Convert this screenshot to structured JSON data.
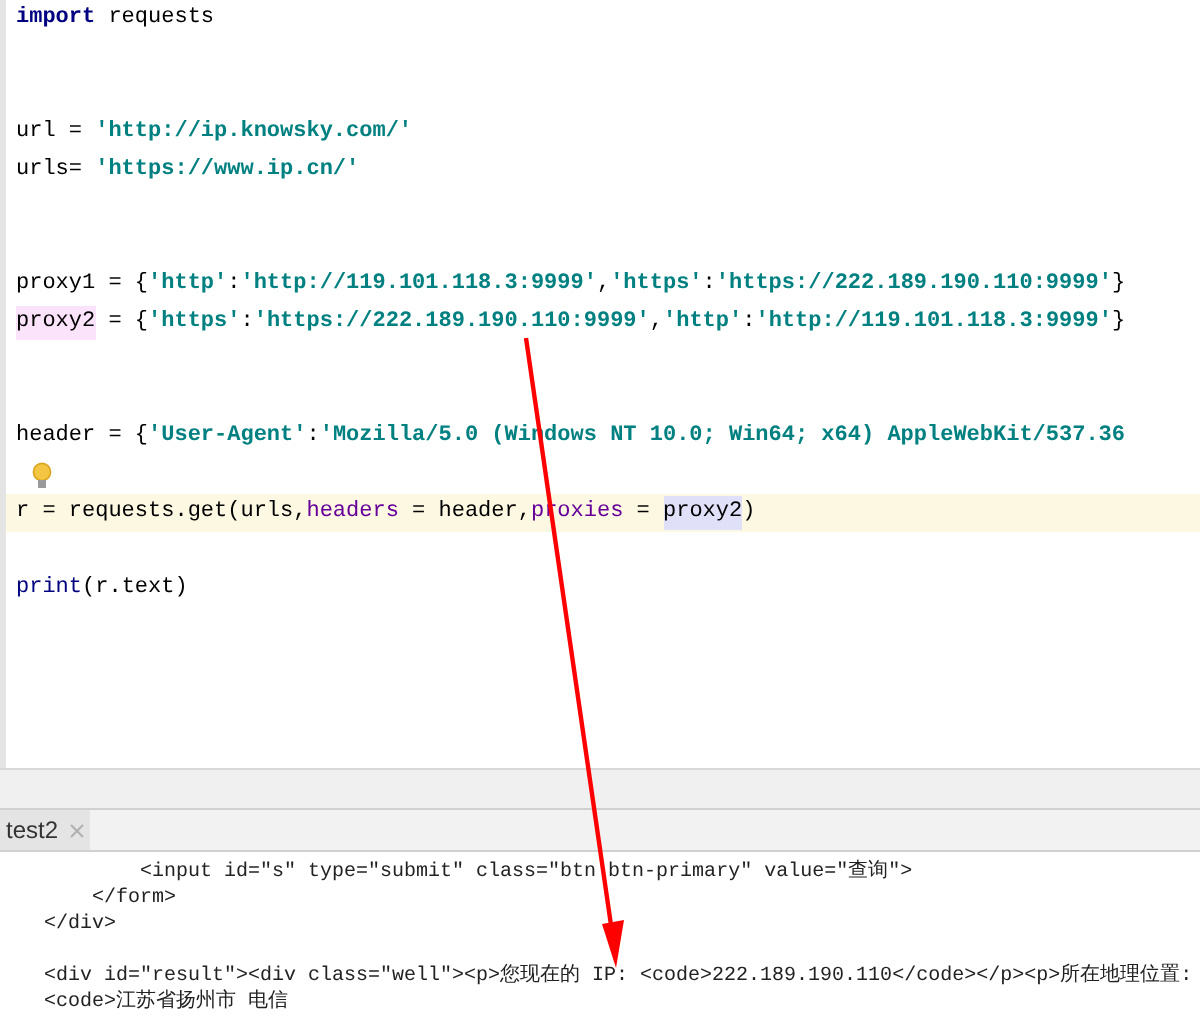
{
  "editor": {
    "lines": [
      {
        "kind": "code",
        "current": false,
        "segments": [
          {
            "kind": "keyword",
            "text": "import"
          },
          {
            "kind": "plain",
            "text": " requests"
          }
        ]
      },
      {
        "kind": "blank"
      },
      {
        "kind": "blank"
      },
      {
        "kind": "code",
        "current": false,
        "segments": [
          {
            "kind": "plain",
            "text": "url = "
          },
          {
            "kind": "string",
            "text": "'http://ip.knowsky.com/'"
          }
        ]
      },
      {
        "kind": "code",
        "current": false,
        "segments": [
          {
            "kind": "plain",
            "text": "urls= "
          },
          {
            "kind": "string",
            "text": "'https://www.ip.cn/'"
          }
        ]
      },
      {
        "kind": "blank"
      },
      {
        "kind": "blank"
      },
      {
        "kind": "code",
        "current": false,
        "segments": [
          {
            "kind": "plain",
            "text": "proxy1 = {"
          },
          {
            "kind": "string",
            "text": "'http'"
          },
          {
            "kind": "plain",
            "text": ":"
          },
          {
            "kind": "string",
            "text": "'http://119.101.118.3:9999'"
          },
          {
            "kind": "plain",
            "text": ","
          },
          {
            "kind": "string",
            "text": "'https'"
          },
          {
            "kind": "plain",
            "text": ":"
          },
          {
            "kind": "string",
            "text": "'https://222.189.190.110:9999'"
          },
          {
            "kind": "plain",
            "text": "}"
          }
        ]
      },
      {
        "kind": "code",
        "current": false,
        "segments": [
          {
            "kind": "mark-pink",
            "text": "proxy2"
          },
          {
            "kind": "plain",
            "text": " = {"
          },
          {
            "kind": "string",
            "text": "'https'"
          },
          {
            "kind": "plain",
            "text": ":"
          },
          {
            "kind": "string",
            "text": "'https://222.189.190.110:9999'"
          },
          {
            "kind": "plain",
            "text": ","
          },
          {
            "kind": "string",
            "text": "'http'"
          },
          {
            "kind": "plain",
            "text": ":"
          },
          {
            "kind": "string",
            "text": "'http://119.101.118.3:9999'"
          },
          {
            "kind": "plain",
            "text": "}"
          }
        ]
      },
      {
        "kind": "blank"
      },
      {
        "kind": "blank"
      },
      {
        "kind": "code",
        "current": false,
        "segments": [
          {
            "kind": "plain",
            "text": "header = {"
          },
          {
            "kind": "string",
            "text": "'User-Agent'"
          },
          {
            "kind": "plain",
            "text": ":"
          },
          {
            "kind": "string",
            "text": "'Mozilla/5.0 (Windows NT 10.0; Win64; x64) AppleWebKit/537.36"
          }
        ]
      },
      {
        "kind": "bulb"
      },
      {
        "kind": "code",
        "current": true,
        "segments": [
          {
            "kind": "plain",
            "text": "r = requests.get(urls,"
          },
          {
            "kind": "param",
            "text": "headers"
          },
          {
            "kind": "plain",
            "text": " = header,"
          },
          {
            "kind": "param",
            "text": "proxies"
          },
          {
            "kind": "plain",
            "text": " = "
          },
          {
            "kind": "mark-blue",
            "text": "proxy2"
          },
          {
            "kind": "plain",
            "text": ")"
          }
        ]
      },
      {
        "kind": "blank"
      },
      {
        "kind": "code",
        "current": false,
        "segments": [
          {
            "kind": "builtin",
            "text": "print"
          },
          {
            "kind": "plain",
            "text": "(r.text)"
          }
        ]
      }
    ]
  },
  "tabs": [
    {
      "label": "test2",
      "selected": true
    }
  ],
  "output": {
    "lines": [
      {
        "kind": "text",
        "text": "        <input id=\"s\" type=\"submit\" class=\"btn btn-primary\" value=\"查询\">"
      },
      {
        "kind": "text",
        "text": "    </form>"
      },
      {
        "kind": "text",
        "text": "</div>"
      },
      {
        "kind": "blank"
      },
      {
        "kind": "text",
        "text": "<div id=\"result\"><div class=\"well\"><p>您现在的 IP: <code>222.189.190.110</code></p><p>所在地理位置: <code>江苏省扬州市 电信"
      }
    ]
  }
}
